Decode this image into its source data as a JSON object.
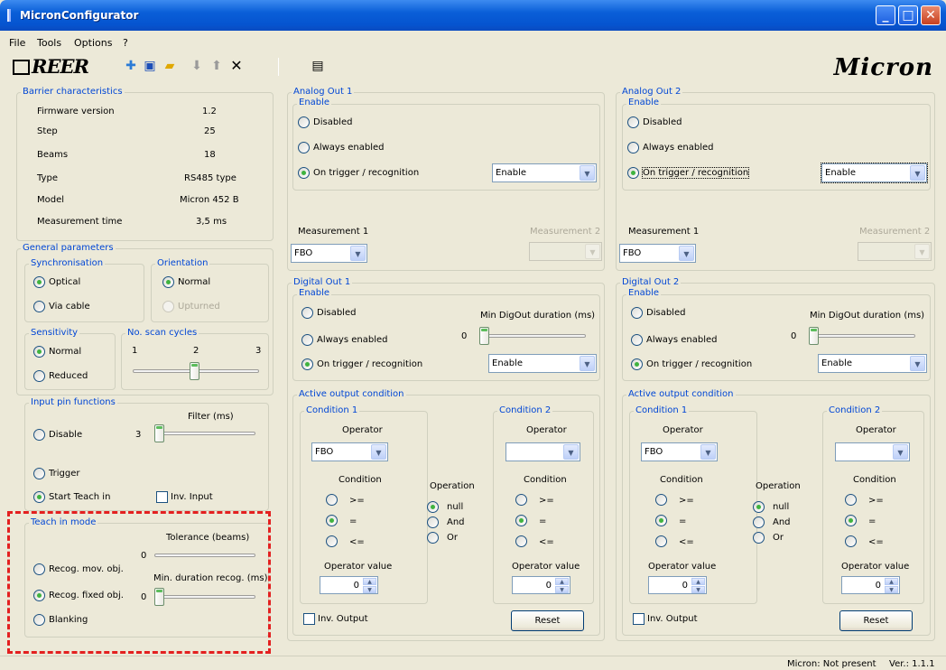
{
  "window": {
    "title": "MicronConfigurator"
  },
  "menu": [
    "File",
    "Tools",
    "Options",
    "?"
  ],
  "toolbar": {
    "brand": "REER",
    "product": "Micron",
    "icons": [
      "new-icon",
      "save-icon",
      "open-folder-icon",
      "download-icon",
      "upload-icon",
      "delete-icon",
      "device-icon"
    ]
  },
  "barrier": {
    "legend": "Barrier characteristics",
    "rows": [
      {
        "label": "Firmware version",
        "value": "1.2"
      },
      {
        "label": "Step",
        "value": "25"
      },
      {
        "label": "Beams",
        "value": "18"
      },
      {
        "label": "Type",
        "value": "RS485 type"
      },
      {
        "label": "Model",
        "value": "Micron  452 B"
      },
      {
        "label": "Measurement time",
        "value": "3,5 ms"
      }
    ]
  },
  "general": {
    "legend": "General parameters",
    "sync": {
      "legend": "Synchronisation",
      "optical": "Optical",
      "cable": "Via cable"
    },
    "orientation": {
      "legend": "Orientation",
      "normal": "Normal",
      "upturned": "Upturned"
    },
    "sensitivity": {
      "legend": "Sensitivity",
      "normal": "Normal",
      "reduced": "Reduced"
    },
    "scan": {
      "legend": "No. scan cycles",
      "min": "1",
      "mid": "2",
      "max": "3",
      "value": 2
    }
  },
  "inputpin": {
    "legend": "Input pin functions",
    "filter_label": "Filter (ms)",
    "filter_value": "3",
    "disable": "Disable",
    "trigger": "Trigger",
    "start_teach": "Start Teach in",
    "inv_input": "Inv. Input"
  },
  "teach": {
    "legend": "Teach in mode",
    "tolerance_label": "Tolerance (beams)",
    "tolerance_value": "0",
    "min_duration_label": "Min. duration recog. (ms)",
    "min_duration_value": "0",
    "mov": "Recog. mov. obj.",
    "fixed": "Recog. fixed obj.",
    "blanking": "Blanking"
  },
  "analog1": {
    "legend": "Analog Out 1",
    "enable_legend": "Enable",
    "disabled": "Disabled",
    "always": "Always enabled",
    "trigger": "On trigger / recognition",
    "combo": "Enable",
    "m1_label": "Measurement 1",
    "m1": "FBO",
    "m2_label": "Measurement 2",
    "m2": ""
  },
  "analog2": {
    "legend": "Analog Out 2",
    "enable_legend": "Enable",
    "disabled": "Disabled",
    "always": "Always enabled",
    "trigger": "On trigger / recognition",
    "combo": "Enable",
    "m1_label": "Measurement 1",
    "m1": "FBO",
    "m2_label": "Measurement 2",
    "m2": ""
  },
  "digital1": {
    "legend": "Digital Out 1",
    "enable_legend": "Enable",
    "disabled": "Disabled",
    "always": "Always enabled",
    "trigger": "On trigger / recognition",
    "combo": "Enable",
    "min_label": "Min DigOut duration (ms)",
    "min_value": "0"
  },
  "digital2": {
    "legend": "Digital Out 2",
    "enable_legend": "Enable",
    "disabled": "Disabled",
    "always": "Always enabled",
    "trigger": "On trigger / recognition",
    "combo": "Enable",
    "min_label": "Min DigOut duration (ms)",
    "min_value": "0"
  },
  "cond1": {
    "legend": "Active output condition",
    "c1": "Condition 1",
    "c2": "Condition 2",
    "operator": "Operator",
    "c1_op": "FBO",
    "c2_op": "",
    "condition": "Condition",
    "ge": ">=",
    "eq": "=",
    "le": "<=",
    "operation": "Operation",
    "null": "null",
    "and": "And",
    "or": "Or",
    "opval": "Operator value",
    "v1": "0",
    "v2": "0",
    "inv_output": "Inv. Output",
    "reset": "Reset"
  },
  "cond2": {
    "legend": "Active output condition",
    "c1": "Condition 1",
    "c2": "Condition 2",
    "operator": "Operator",
    "c1_op": "FBO",
    "c2_op": "",
    "condition": "Condition",
    "ge": ">=",
    "eq": "=",
    "le": "<=",
    "operation": "Operation",
    "null": "null",
    "and": "And",
    "or": "Or",
    "opval": "Operator value",
    "v1": "0",
    "v2": "0",
    "inv_output": "Inv. Output",
    "reset": "Reset"
  },
  "status": {
    "device": "Micron: Not present",
    "version": "Ver.: 1.1.1"
  }
}
